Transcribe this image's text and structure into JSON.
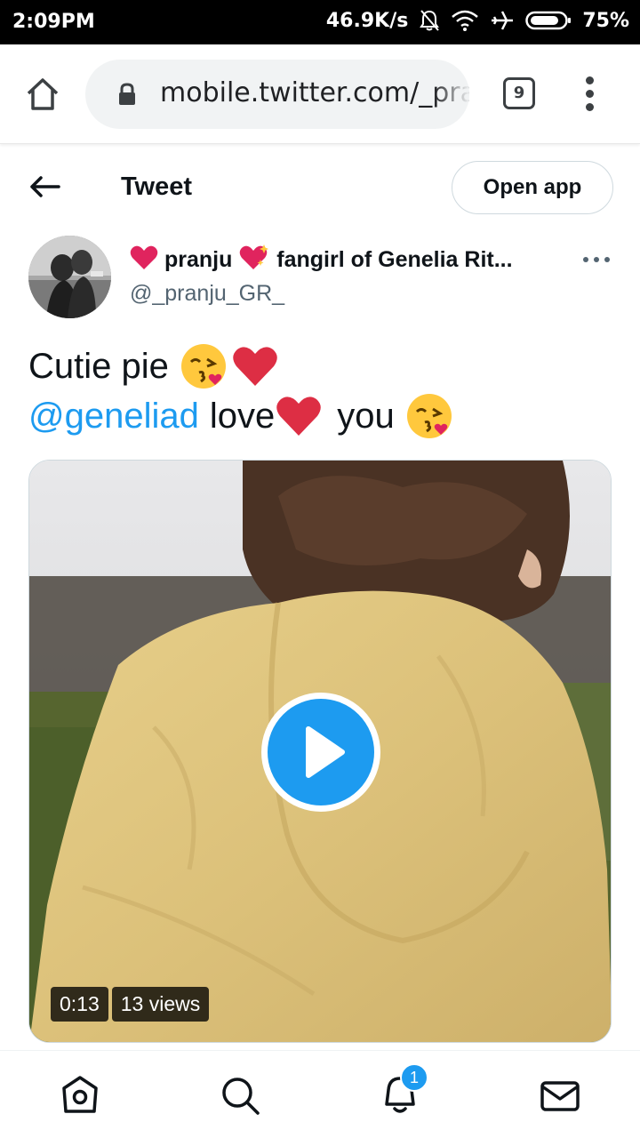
{
  "status_bar": {
    "time": "2:09PM",
    "network_speed": "46.9K/s",
    "battery": "75%",
    "icons": [
      "bell-off-icon",
      "wifi-icon",
      "airplane-icon",
      "battery-icon"
    ]
  },
  "browser": {
    "url": "mobile.twitter.com/_pranju_GR_",
    "tab_count": "9"
  },
  "header": {
    "title": "Tweet",
    "open_app_label": "Open app"
  },
  "tweet": {
    "display_name": "pranju fangirl of Genelia Rit...",
    "display_name_parts": {
      "part1": "pranju",
      "part2": "fangirl of Genelia Rit..."
    },
    "handle": "@_pranju_GR_",
    "text_line1_word": "Cutie pie",
    "mention": "@geneliad",
    "text_line2_love": "love",
    "text_line2_you": "you",
    "video": {
      "duration": "0:13",
      "views": "13 views"
    }
  },
  "bottom_nav": {
    "items": [
      "home-icon",
      "search-icon",
      "notifications-icon",
      "messages-icon"
    ],
    "notification_count": "1"
  },
  "colors": {
    "accent": "#1d9bf0",
    "text": "#0f1419",
    "secondary_text": "#536471",
    "heart": "#e0245e"
  }
}
